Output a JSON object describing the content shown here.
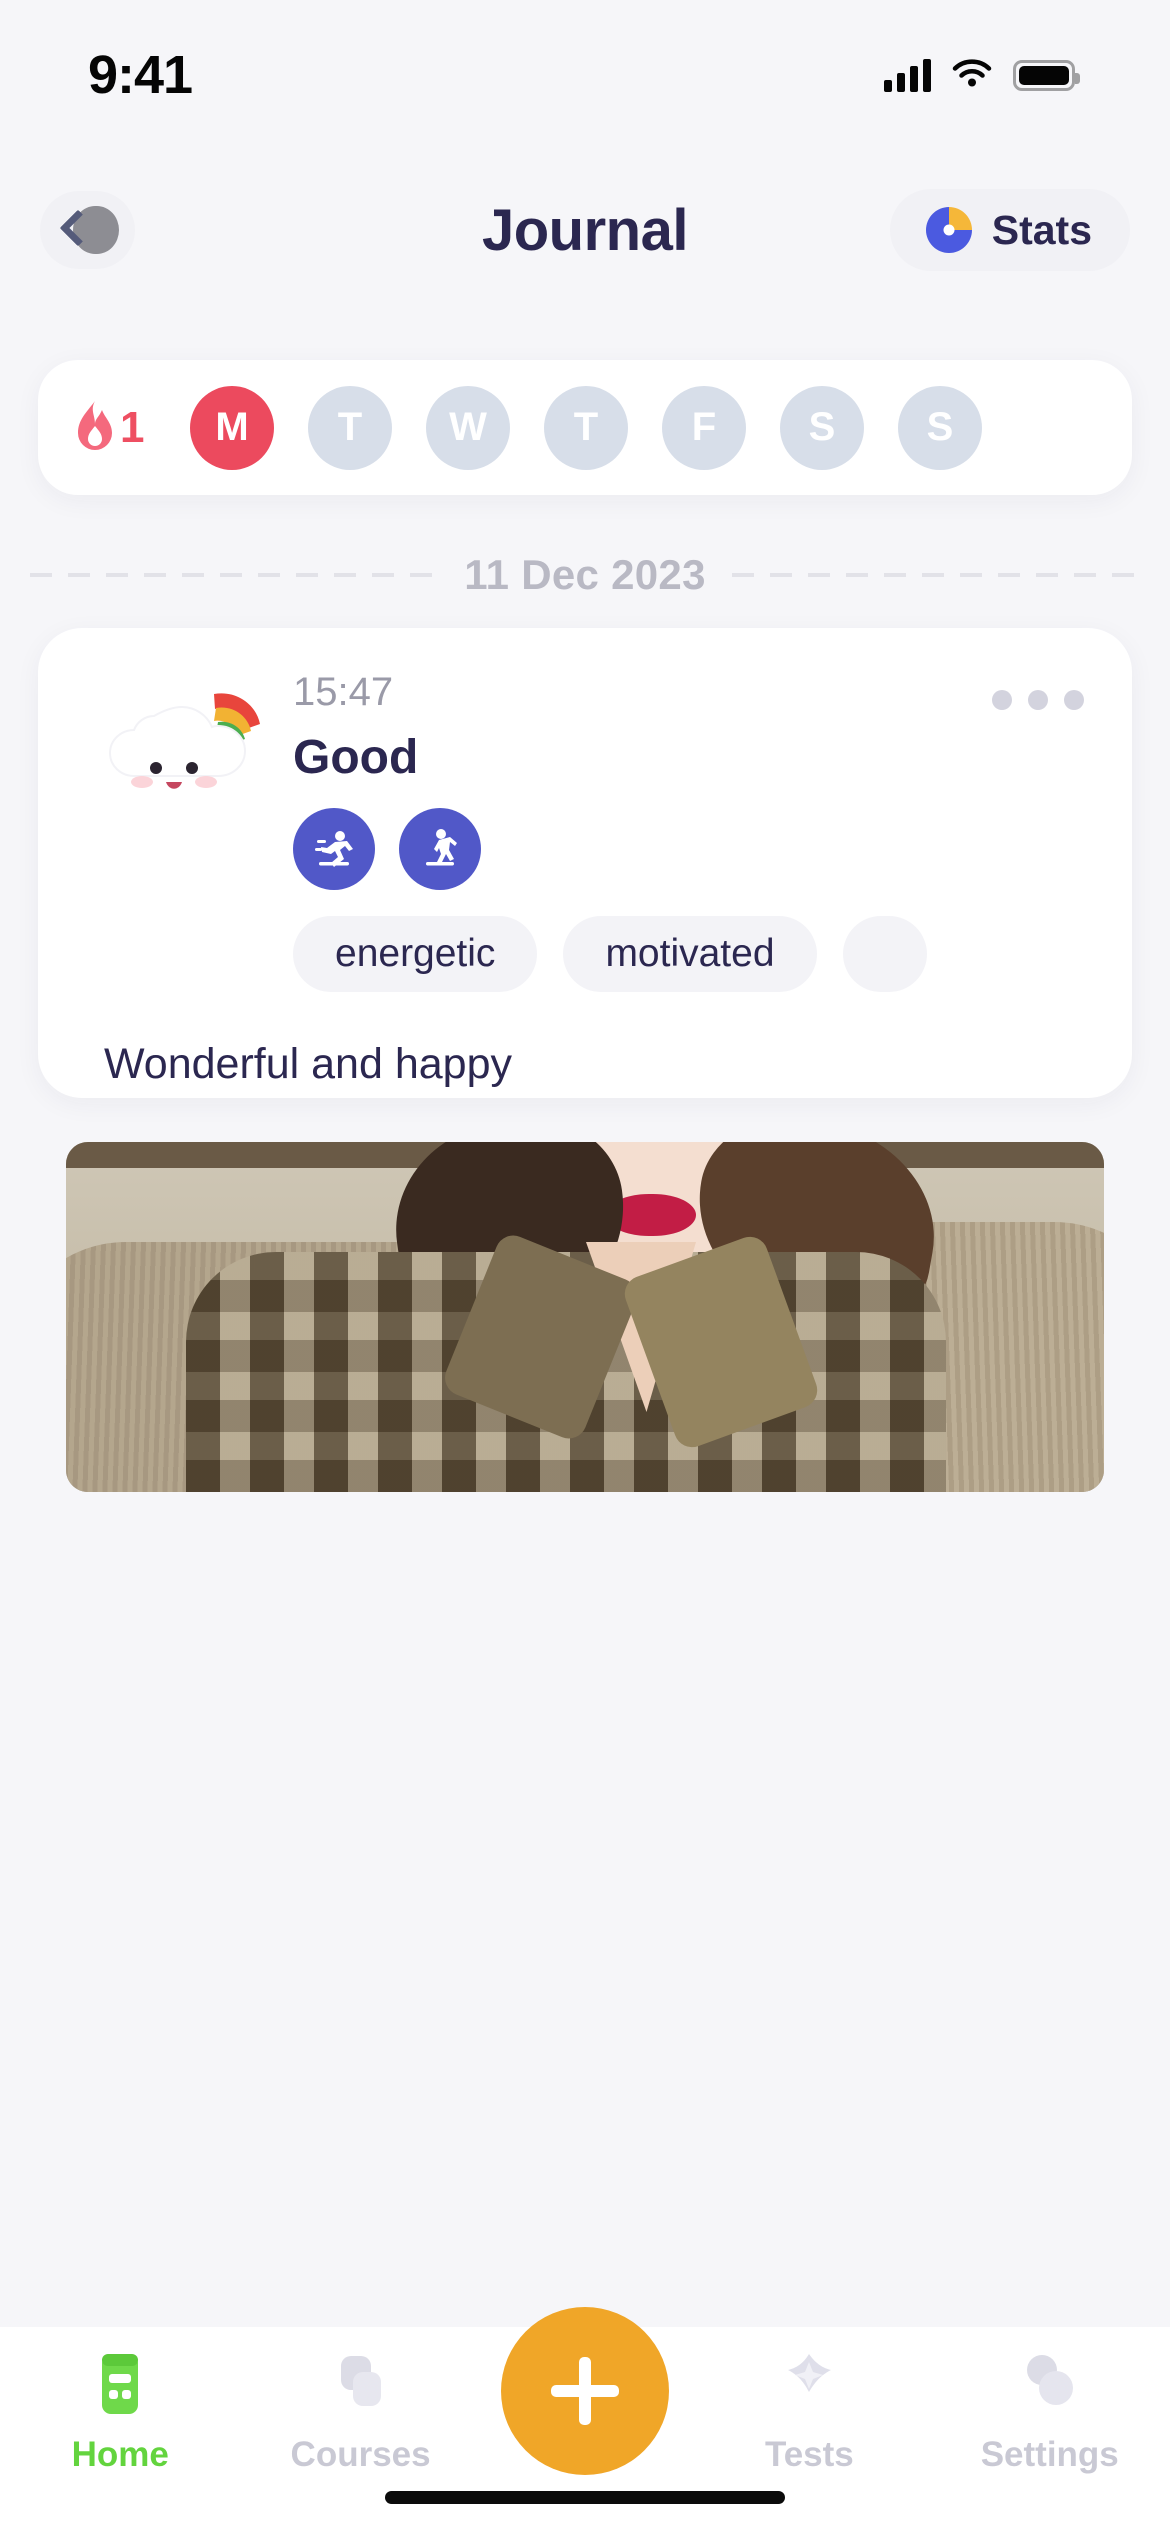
{
  "status_bar": {
    "time": "9:41",
    "cellular_icon": "signal-bars-icon",
    "wifi_icon": "wifi-icon",
    "battery_icon": "battery-icon"
  },
  "header": {
    "back_icon": "back-chevron-icon",
    "title": "Journal",
    "stats_label": "Stats",
    "stats_icon": "pie-chart-icon"
  },
  "streak": {
    "flame_icon": "flame-icon",
    "count": "1",
    "days": [
      {
        "letter": "M",
        "active": true
      },
      {
        "letter": "T",
        "active": false
      },
      {
        "letter": "W",
        "active": false
      },
      {
        "letter": "T",
        "active": false
      },
      {
        "letter": "F",
        "active": false
      },
      {
        "letter": "S",
        "active": false
      },
      {
        "letter": "S",
        "active": false
      }
    ]
  },
  "date_divider": {
    "date": "11 Dec 2023"
  },
  "entry": {
    "time": "15:47",
    "mood": "Good",
    "mood_art_icon": "happy-cloud-rainbow-icon",
    "menu_icon": "more-dots-icon",
    "activities": [
      {
        "icon": "running-icon"
      },
      {
        "icon": "walking-icon"
      }
    ],
    "tags": [
      "energetic",
      "motivated",
      ""
    ],
    "note": "Wonderful and happy",
    "photo_alt": "journal-photo"
  },
  "bottom_nav": {
    "items": [
      {
        "label": "Home",
        "icon": "books-icon",
        "active": true
      },
      {
        "label": "Courses",
        "icon": "layers-icon",
        "active": false
      },
      {
        "label": "Tests",
        "icon": "sparkle-icon",
        "active": false
      },
      {
        "label": "Settings",
        "icon": "gears-icon",
        "active": false
      }
    ],
    "add_label": "+",
    "add_icon": "plus-icon"
  },
  "colors": {
    "background": "#f6f6f9",
    "card": "#ffffff",
    "title": "#2b2750",
    "streak_active": "#ec4a5e",
    "streak_inactive": "#d7dee9",
    "activity_badge": "#5158c8",
    "accent_fab": "#f0a628",
    "nav_active": "#63d43e",
    "muted_text": "#b9b9c4"
  }
}
